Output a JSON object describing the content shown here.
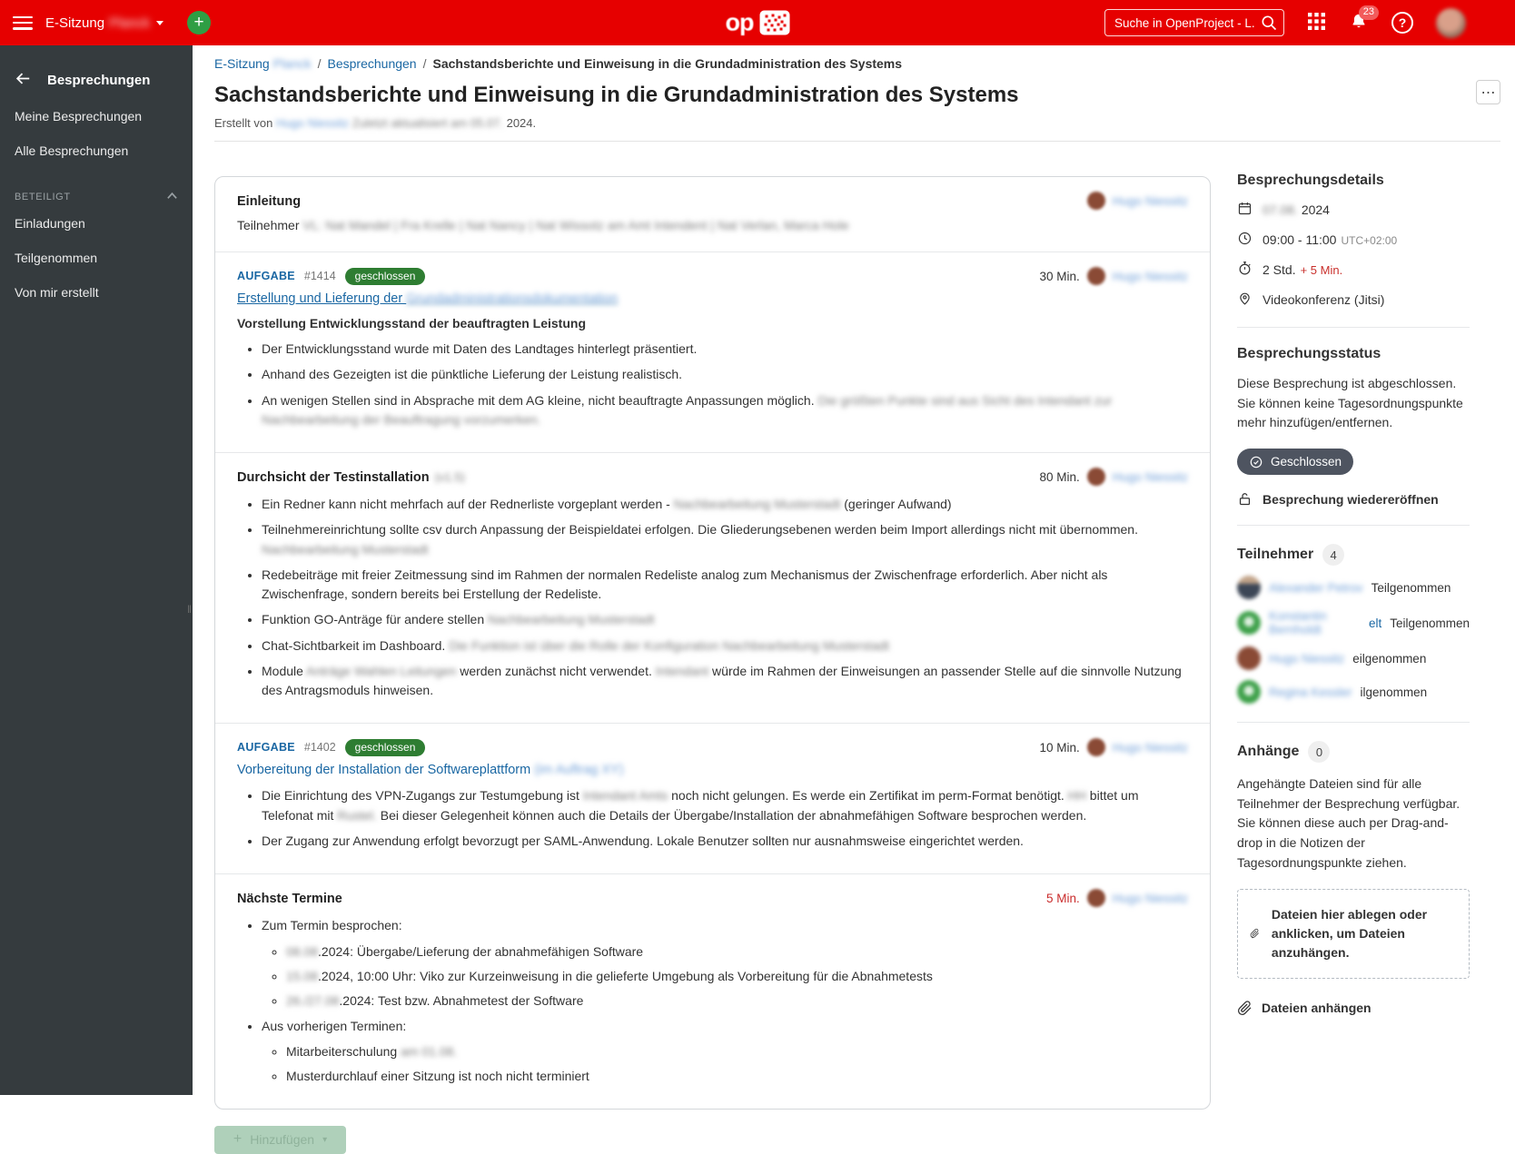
{
  "header": {
    "project_label": "E-Sitzung",
    "project_blur": "Planck",
    "search_placeholder": "Suche in OpenProject - L...",
    "notification_count": "23",
    "help_label": "?"
  },
  "sidebar": {
    "title": "Besprechungen",
    "items": [
      "Meine Besprechungen",
      "Alle Besprechungen"
    ],
    "group_label": "BETEILIGT",
    "group_items": [
      "Einladungen",
      "Teilgenommen",
      "Von mir erstellt"
    ]
  },
  "breadcrumb": {
    "project": "E-Sitzung",
    "project_blur": "Planck",
    "separator": "/",
    "section": "Besprechungen",
    "current": "Sachstandsberichte und Einweisung in die Grundadministration des Systems"
  },
  "page": {
    "title": "Sachstandsberichte und Einweisung in die Grundadministration des Systems",
    "byline_prefix": "Erstellt von",
    "byline_name_blur": "Hugo Niessitz",
    "byline_mid_blur": "Zuletzt aktualisiert am 05.07.",
    "byline_suffix": "2024.",
    "more_label": "⋯"
  },
  "agenda": {
    "items": [
      {
        "title": "Einleitung",
        "title_blur": "",
        "duration": "",
        "red": false,
        "author_blur": "Hugo Niessitz",
        "body": [
          {
            "k": "p",
            "parts": [
              [
                "t",
                "Teilnehmer "
              ],
              [
                "x",
                "VL: Nat Mandel | Fra Krelle | Nat Nancy | Nat Wissotz am Amt Intendent | Nat Verlan, Marca Hole"
              ]
            ]
          }
        ]
      },
      {
        "wp_type": "AUFGABE",
        "wp_id": "#1414",
        "wp_status": "geschlossen",
        "link_underline": true,
        "link_parts": [
          [
            "l",
            "Erstellung und Lieferung der "
          ],
          [
            "L",
            "Grundadministrationsdokumentation"
          ]
        ],
        "duration": "30 Min.",
        "red": false,
        "author_blur": "Hugo Niessitz",
        "body": [
          {
            "k": "b",
            "parts": [
              [
                "t",
                "Vorstellung Entwicklungsstand der beauftragten Leistung"
              ]
            ]
          },
          {
            "k": "ul",
            "items": [
              {
                "parts": [
                  [
                    "t",
                    "Der Entwicklungsstand wurde mit Daten des Landtages hinterlegt präsentiert."
                  ]
                ]
              },
              {
                "parts": [
                  [
                    "t",
                    "Anhand des Gezeigten ist die pünktliche Lieferung der Leistung realistisch."
                  ]
                ]
              },
              {
                "parts": [
                  [
                    "t",
                    "An wenigen Stellen sind in Absprache mit dem AG kleine, nicht beauftragte Anpassungen möglich. "
                  ],
                  [
                    "x",
                    "Die größten Punkte sind aus Sicht des Intendant zur Nachbearbeitung der Beauftragung vorzumerken."
                  ]
                ]
              }
            ]
          }
        ]
      },
      {
        "title": "Durchsicht der Testinstallation",
        "title_blur": "(v1.5)",
        "duration": "80 Min.",
        "red": false,
        "author_blur": "Hugo Niessitz",
        "body": [
          {
            "k": "ul",
            "items": [
              {
                "parts": [
                  [
                    "t",
                    "Ein Redner kann nicht mehrfach auf der Rednerliste vorgeplant werden - "
                  ],
                  [
                    "x",
                    "Nachbearbeitung Musterstadt"
                  ],
                  [
                    "t",
                    " (geringer Aufwand)"
                  ]
                ]
              },
              {
                "parts": [
                  [
                    "t",
                    "Teilnehmereinrichtung sollte csv durch Anpassung der Beispieldatei erfolgen. Die Gliederungsebenen werden beim Import allerdings nicht mit übernommen. "
                  ],
                  [
                    "x",
                    "Nachbearbeitung Musterstadt"
                  ]
                ]
              },
              {
                "parts": [
                  [
                    "t",
                    "Redebeiträge mit freier Zeitmessung sind im Rahmen der normalen Redeliste analog zum Mechanismus der Zwischenfrage erforderlich. Aber nicht als Zwischenfrage, sondern bereits bei Erstellung der Redeliste."
                  ]
                ]
              },
              {
                "parts": [
                  [
                    "t",
                    "Funktion GO-Anträge für andere stellen "
                  ],
                  [
                    "x",
                    "Nachbearbeitung Musterstadt"
                  ]
                ]
              },
              {
                "parts": [
                  [
                    "t",
                    "Chat-Sichtbarkeit im Dashboard. "
                  ],
                  [
                    "x",
                    "Die Funktion ist über die Rolle der Konfiguration Nachbearbeitung Musterstadt"
                  ]
                ]
              },
              {
                "parts": [
                  [
                    "t",
                    "Module "
                  ],
                  [
                    "x",
                    "Anträge Wahlen Leitungen"
                  ],
                  [
                    "t",
                    " werden zunächst nicht verwendet. "
                  ],
                  [
                    "x",
                    "Intendant"
                  ],
                  [
                    "t",
                    " würde im Rahmen der Einweisungen an passender Stelle auf die sinnvolle Nutzung des Antragsmoduls hinweisen."
                  ]
                ]
              }
            ]
          }
        ]
      },
      {
        "wp_type": "AUFGABE",
        "wp_id": "#1402",
        "wp_status": "geschlossen",
        "link_underline": false,
        "link_parts": [
          [
            "l",
            "Vorbereitung der Installation der Softwareplattform "
          ],
          [
            "L",
            "(im Auftrag XY)"
          ]
        ],
        "duration": "10 Min.",
        "red": false,
        "author_blur": "Hugo Niessitz",
        "body": [
          {
            "k": "ul",
            "items": [
              {
                "parts": [
                  [
                    "t",
                    "Die Einrichtung des VPN-Zugangs zur Testumgebung ist "
                  ],
                  [
                    "x",
                    "Intendant Amts"
                  ],
                  [
                    "t",
                    " noch nicht gelungen. Es werde ein Zertifikat im perm-Format benötigt. "
                  ],
                  [
                    "x",
                    "HH"
                  ],
                  [
                    "t",
                    " bittet um Telefonat mit "
                  ],
                  [
                    "x",
                    "Rustel."
                  ],
                  [
                    "t",
                    " Bei dieser Gelegenheit können auch die Details der Übergabe/Installation der abnahmefähigen Software besprochen werden."
                  ]
                ]
              },
              {
                "parts": [
                  [
                    "t",
                    "Der Zugang zur Anwendung erfolgt bevorzugt per SAML-Anwendung. Lokale Benutzer sollten nur ausnahmsweise eingerichtet werden."
                  ]
                ]
              }
            ]
          }
        ]
      },
      {
        "title": "Nächste Termine",
        "title_blur": "",
        "duration": "5 Min.",
        "red": true,
        "author_blur": "Hugo Niessitz",
        "body": [
          {
            "k": "ul",
            "items": [
              {
                "parts": [
                  [
                    "t",
                    "Zum Termin besprochen:"
                  ]
                ],
                "sub": [
                  {
                    "parts": [
                      [
                        "x",
                        "08.08"
                      ],
                      [
                        "t",
                        ".2024: Übergabe/Lieferung der abnahmefähigen Software"
                      ]
                    ]
                  },
                  {
                    "parts": [
                      [
                        "x",
                        "15.08"
                      ],
                      [
                        "t",
                        ".2024, 10:00 Uhr: Viko zur Kurzeinweisung in die gelieferte Umgebung als Vorbereitung für die Abnahmetests"
                      ]
                    ]
                  },
                  {
                    "parts": [
                      [
                        "x",
                        "26./27.08"
                      ],
                      [
                        "t",
                        ".2024: Test bzw. Abnahmetest der Software"
                      ]
                    ]
                  }
                ]
              },
              {
                "parts": [
                  [
                    "t",
                    "Aus vorherigen Terminen:"
                  ]
                ],
                "sub": [
                  {
                    "parts": [
                      [
                        "t",
                        "Mitarbeiterschulung "
                      ],
                      [
                        "x",
                        "am 01.08."
                      ]
                    ]
                  },
                  {
                    "parts": [
                      [
                        "t",
                        "Musterdurchlauf einer Sitzung ist noch nicht terminiert"
                      ]
                    ]
                  }
                ]
              }
            ]
          }
        ]
      }
    ],
    "add_button": {
      "label": "Hinzufügen",
      "plus": "+",
      "caret": "▾"
    }
  },
  "details": {
    "heading": "Besprechungsdetails",
    "rows": [
      {
        "icon": "calendar-icon",
        "parts": [
          [
            "x",
            "07.08. "
          ],
          [
            "t",
            "2024"
          ]
        ]
      },
      {
        "icon": "clock-icon",
        "parts": [
          [
            "t",
            "09:00 - 11:00"
          ],
          [
            "u",
            "UTC+02:00"
          ]
        ]
      },
      {
        "icon": "stopwatch-icon",
        "parts": [
          [
            "t",
            "2 Std."
          ],
          [
            "r",
            "+ 5 Min."
          ]
        ]
      },
      {
        "icon": "location-icon",
        "parts": [
          [
            "t",
            "Videokonferenz (Jitsi)"
          ]
        ]
      }
    ]
  },
  "status": {
    "heading": "Besprechungsstatus",
    "text": "Diese Besprechung ist abgeschlossen. Sie können keine Tagesordnungspunkte mehr hinzufügen/entfernen.",
    "badge": "Geschlossen",
    "reopen": "Besprechung wiedereröffnen"
  },
  "participants": {
    "heading": "Teilnehmer",
    "count": "4",
    "rows": [
      {
        "avatar": "photo",
        "name_blur": "Alexander Petrov",
        "tail": "",
        "status": "Teilgenommen"
      },
      {
        "avatar": "green",
        "name_blur": "Konstantin Bernholdt",
        "tail": "elt",
        "status": "Teilgenommen"
      },
      {
        "avatar": "brown",
        "name_blur": "Hugo Niessitz",
        "tail": "",
        "status": "eilgenommen"
      },
      {
        "avatar": "green",
        "name_blur": "Regina Kessler",
        "tail": "",
        "status": "ilgenommen"
      }
    ]
  },
  "attachments": {
    "heading": "Anhänge",
    "count": "0",
    "text": "Angehängte Dateien sind für alle Teilnehmer der Besprechung verfügbar. Sie können diese auch per Drag-and-drop in die Notizen der Tagesordnungspunkte ziehen.",
    "dropzone": "Dateien hier ablegen oder anklicken, um Dateien anzuhängen.",
    "attach_link": "Dateien anhängen"
  }
}
